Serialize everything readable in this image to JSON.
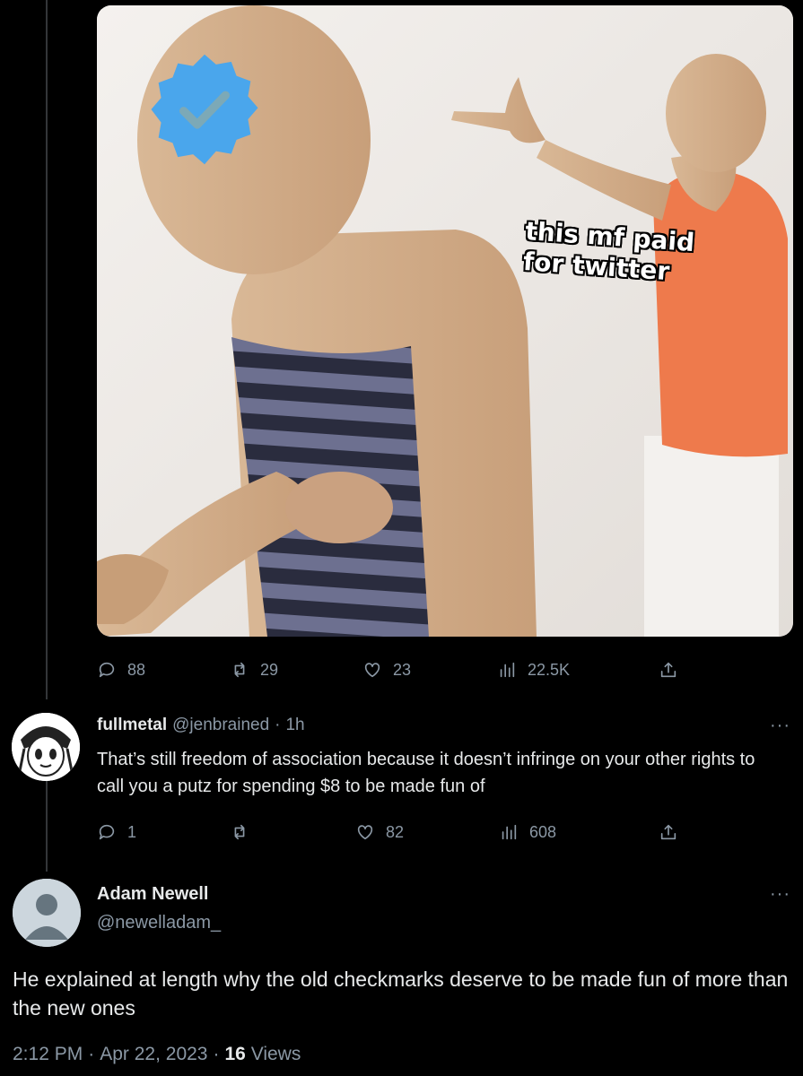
{
  "meme": {
    "caption": "this mf paid\nfor twitter"
  },
  "original_tweet_actions": {
    "replies": "88",
    "retweets": "29",
    "likes": "23",
    "views": "22.5K"
  },
  "reply_tweet": {
    "name": "fullmetal",
    "handle": "@jenbrained",
    "separator": "·",
    "time": "1h",
    "more": "···",
    "text": "That’s still freedom of association because it doesn’t infringe on your other rights to call you a putz for spending $8 to be made fun of",
    "actions": {
      "replies": "1",
      "retweets": "",
      "likes": "82",
      "views": "608"
    }
  },
  "main_tweet": {
    "name": "Adam Newell",
    "handle": "@newelladam_",
    "more": "···",
    "text": "He explained at length why the old checkmarks deserve to be made fun of more than the new ones",
    "time": "2:12 PM",
    "dot1": "·",
    "date": "Apr 22, 2023",
    "dot2": "·",
    "views_count": "16",
    "views_label": "Views"
  },
  "colors": {
    "background": "#000000",
    "text": "#e7e9ea",
    "muted": "#8b98a5",
    "verified_blue": "#4aa6ec",
    "shirt_orange": "#f07a4a"
  },
  "icons": [
    "reply-icon",
    "retweet-icon",
    "like-icon",
    "views-icon",
    "share-icon",
    "verified-badge-icon",
    "more-icon",
    "default-avatar-icon"
  ]
}
